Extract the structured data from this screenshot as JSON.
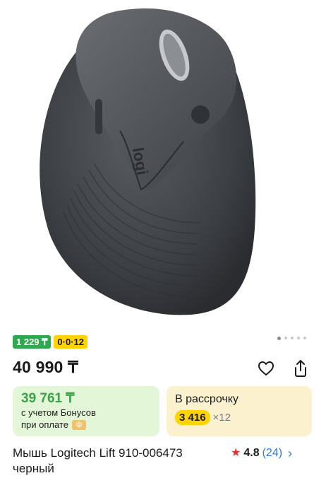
{
  "product": {
    "image_icon": "logitech-lift-mouse-image",
    "gallery": {
      "count": 5,
      "active": 0
    },
    "badges": {
      "old_price": "1 229 ₸",
      "installment": "0·0·12"
    },
    "price": "40 990 ₸",
    "bonus_card": {
      "price": "39 761 ₸",
      "note_line1": "с учетом Бонусов",
      "note_line2": "при оплате",
      "chip": "ф"
    },
    "installment_card": {
      "title": "В рассрочку",
      "amount": "3 416",
      "multiplier": "×12"
    },
    "title": "Мышь Logitech Lift 910-006473 черный",
    "rating": {
      "value": "4.8",
      "count": "(24)",
      "star": "★",
      "chevron": "›"
    },
    "colors": {
      "accent": "#ffd400",
      "green": "#2fa84f",
      "link": "#2c7be5",
      "star": "#e5312f"
    }
  }
}
